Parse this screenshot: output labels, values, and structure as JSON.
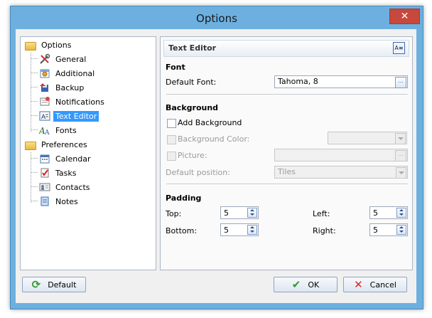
{
  "window": {
    "title": "Options",
    "close_label": "✕"
  },
  "tree": {
    "groups": [
      {
        "label": "Options",
        "icon": "folder-icon",
        "items": [
          {
            "label": "General",
            "icon": "tools-icon"
          },
          {
            "label": "Additional",
            "icon": "additional-settings-icon"
          },
          {
            "label": "Backup",
            "icon": "backup-icon"
          },
          {
            "label": "Notifications",
            "icon": "notifications-icon"
          },
          {
            "label": "Text Editor",
            "icon": "text-editor-icon",
            "selected": true
          },
          {
            "label": "Fonts",
            "icon": "fonts-icon"
          }
        ]
      },
      {
        "label": "Preferences",
        "icon": "folder-icon",
        "items": [
          {
            "label": "Calendar",
            "icon": "calendar-icon"
          },
          {
            "label": "Tasks",
            "icon": "tasks-icon"
          },
          {
            "label": "Contacts",
            "icon": "contacts-icon"
          },
          {
            "label": "Notes",
            "icon": "notes-icon"
          }
        ]
      }
    ]
  },
  "panel": {
    "header": "Text Editor",
    "font": {
      "section": "Font",
      "label": "Default Font:",
      "value": "Tahoma, 8",
      "button": "..."
    },
    "background": {
      "section": "Background",
      "add_label": "Add Background",
      "color_label": "Background Color:",
      "picture_label": "Picture:",
      "picture_button": "...",
      "position_label": "Default position:",
      "position_value": "Tiles"
    },
    "padding": {
      "section": "Padding",
      "top_label": "Top:",
      "top": "5",
      "left_label": "Left:",
      "left": "5",
      "bottom_label": "Bottom:",
      "bottom": "5",
      "right_label": "Right:",
      "right": "5"
    }
  },
  "buttons": {
    "default": "Default",
    "ok": "OK",
    "cancel": "Cancel"
  },
  "colors": {
    "titlebar": "#6db0e0",
    "close": "#c7483d",
    "selection": "#3399ff",
    "ok_check": "#2e9a2e",
    "cancel_x": "#d62828"
  }
}
